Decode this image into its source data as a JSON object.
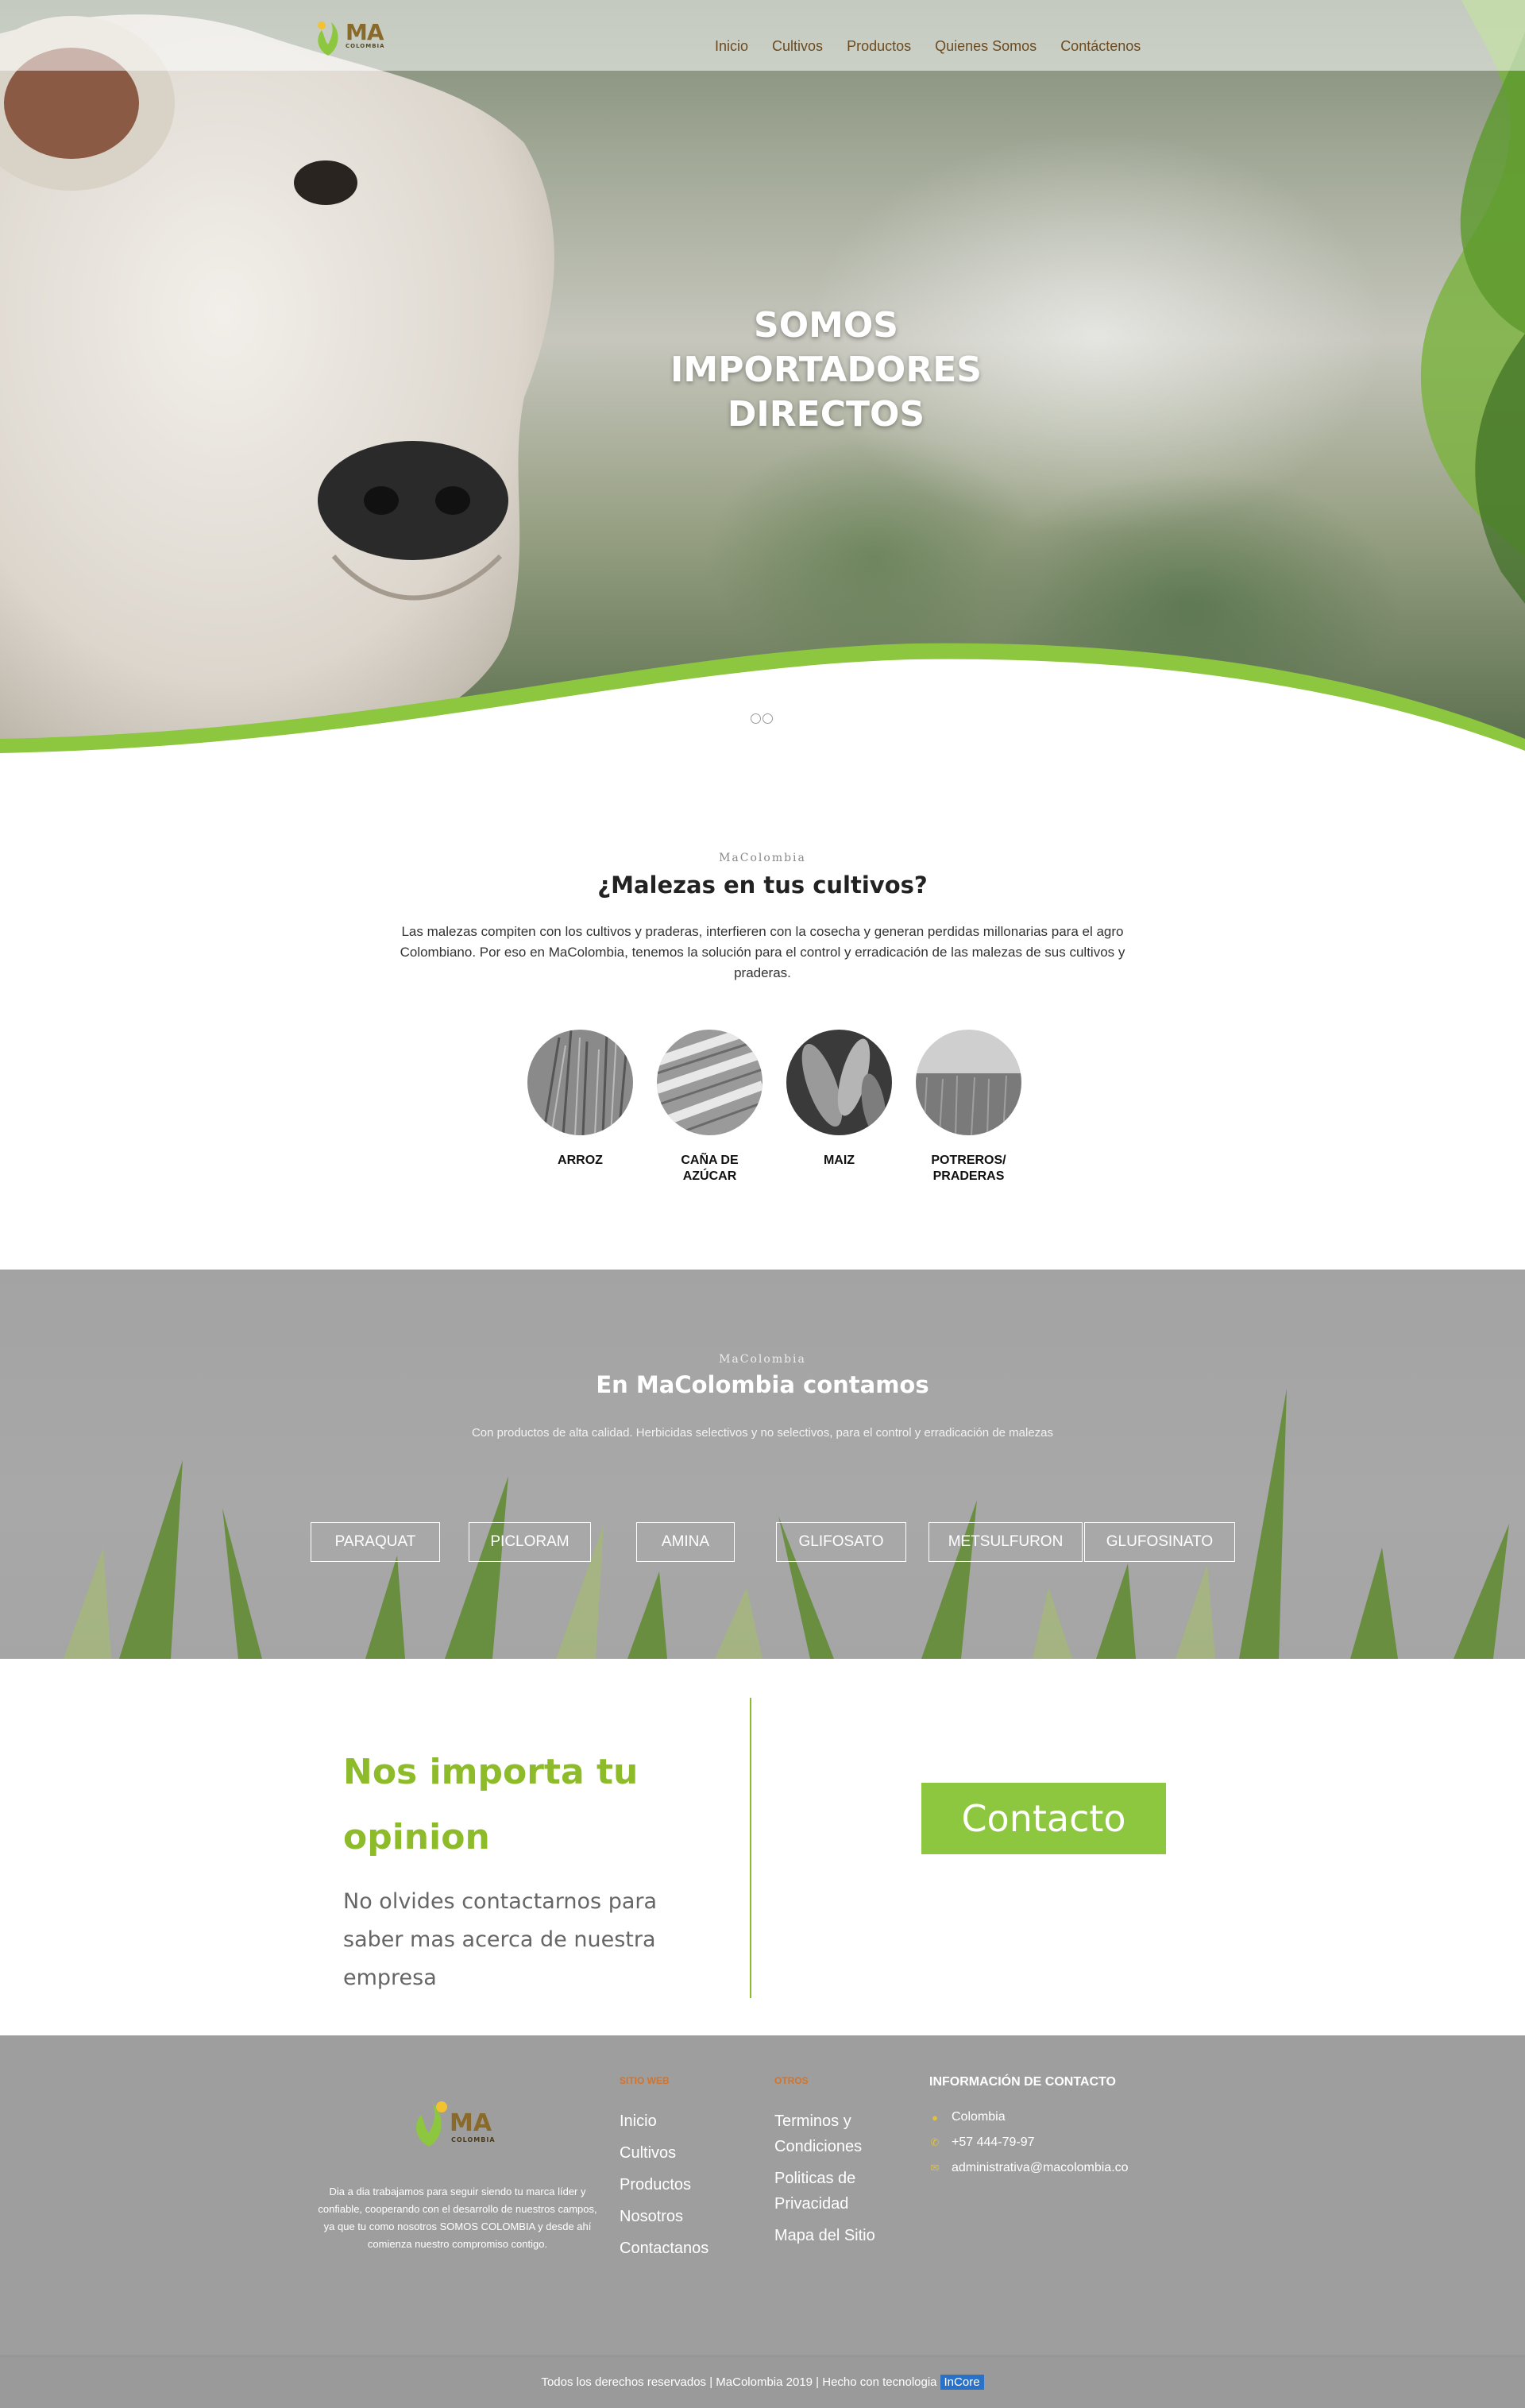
{
  "header": {
    "logo_text": "MA",
    "logo_sub": "COLOMBIA",
    "nav": [
      "Inicio",
      "Cultivos",
      "Productos",
      "Quienes Somos",
      "Contáctenos"
    ]
  },
  "hero": {
    "title_lines": [
      "SOMOS",
      "IMPORTADORES",
      "DIRECTOS"
    ],
    "slides": 2
  },
  "malezas": {
    "label": "MaColombia",
    "title": "¿Malezas en tus cultivos?",
    "text": "Las malezas compiten con los cultivos y praderas, interfieren con la cosecha y generan perdidas millonarias para el agro Colombiano. Por eso en MaColombia, tenemos la solución para el control y erradicación de las malezas de sus cultivos y praderas.",
    "crops": [
      "ARROZ",
      "CAÑA DE AZÚCAR",
      "MAIZ",
      "POTREROS/ PRADERAS"
    ]
  },
  "productos": {
    "label": "MaColombia",
    "title": "En MaColombia contamos",
    "text": "Con productos de alta calidad. Herbicidas selectivos y no selectivos, para el control y erradicación de malezas",
    "items": [
      "PARAQUAT",
      "PICLORAM",
      "AMINA",
      "GLIFOSATO",
      "METSULFURON",
      "GLUFOSINATO"
    ]
  },
  "opinion": {
    "title": "Nos importa tu opinion",
    "text": "No olvides contactarnos para saber mas acerca de nuestra empresa",
    "button": "Contacto"
  },
  "footer": {
    "about": "Dia a dia trabajamos para seguir siendo tu marca líder y confiable, cooperando con el desarrollo de nuestros campos, ya que tu como nosotros SOMOS COLOMBIA y desde ahí comienza nuestro compromiso contigo.",
    "site_head": "SITIO WEB",
    "site_links": [
      "Inicio",
      "Cultivos",
      "Productos",
      "Nosotros",
      "Contactanos"
    ],
    "others_head": "OTROS",
    "others_links": [
      "Terminos y Condiciones",
      "Politicas de Privacidad",
      "Mapa del Sitio"
    ],
    "contact_head": "INFORMACIÓN DE CONTACTO",
    "contact": {
      "location": "Colombia",
      "phone": "+57 444-79-97",
      "email": "administrativa@macolombia.co"
    },
    "copyright": "Todos los derechos reservados | MaColombia 2019 | Hecho con tecnologia",
    "brand": "InCore"
  },
  "colors": {
    "accent_green": "#8dc63f",
    "title_green": "#8dbb2a",
    "footer_bg": "#9e9e9e",
    "footer_head": "#d4732a"
  }
}
